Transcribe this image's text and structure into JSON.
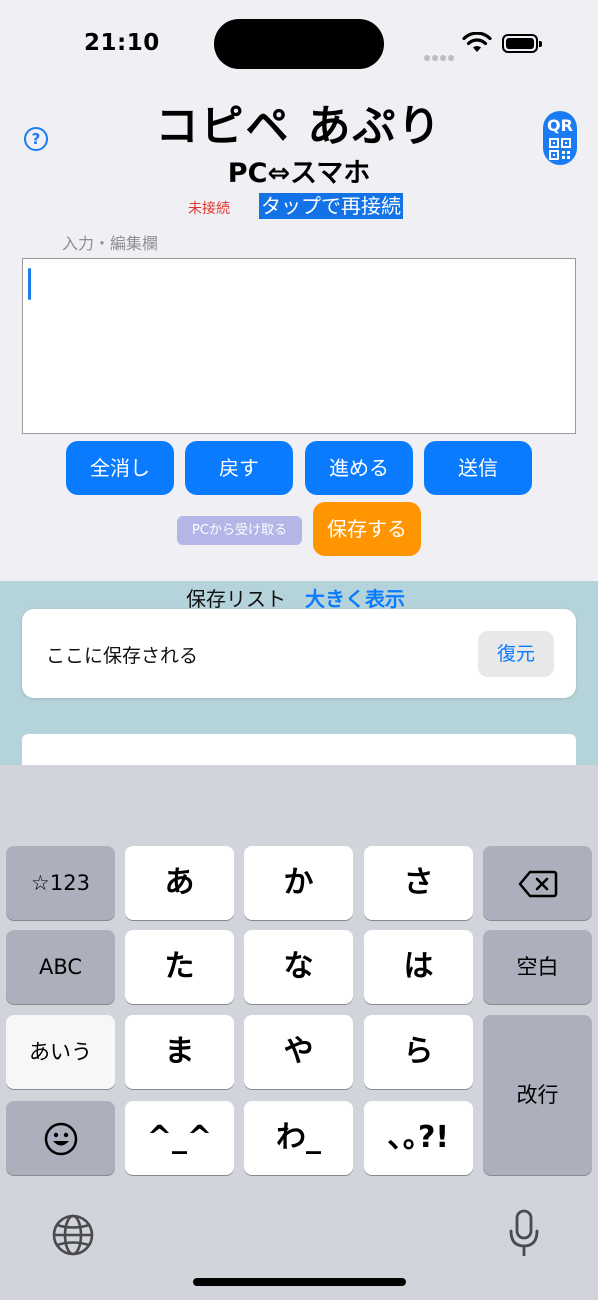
{
  "status_bar": {
    "time": "21:10"
  },
  "header": {
    "help_icon": "?",
    "title": "コピペ あぷり",
    "subtitle": "PC⇔スマホ",
    "qr_label": "QR"
  },
  "connection": {
    "status": "未接続",
    "reconnect_label": "タップで再接続"
  },
  "editor": {
    "label": "入力・編集欄",
    "value": ""
  },
  "actions": {
    "clear": "全消し",
    "back": "戻す",
    "forward": "進める",
    "send": "送信",
    "receive": "PCから受け取る",
    "save": "保存する"
  },
  "saved_list": {
    "title": "保存リスト",
    "large_view": "大きく表示",
    "items": [
      {
        "text": "ここに保存される",
        "restore": "復元"
      }
    ]
  },
  "keyboard": {
    "row1": [
      "☆123",
      "あ",
      "か",
      "さ"
    ],
    "row2": [
      "ABC",
      "た",
      "な",
      "は",
      "空白"
    ],
    "row3": [
      "あいう",
      "ま",
      "や",
      "ら"
    ],
    "row4": [
      "^_^",
      "わ_",
      "､｡?!"
    ],
    "enter": "改行",
    "backspace_icon": "backspace-icon",
    "emoji_icon": "emoji-icon",
    "globe_icon": "globe-icon",
    "mic_icon": "mic-icon"
  },
  "colors": {
    "accent": "#0a7aff",
    "save": "#ff9500",
    "receive": "#b3b6e6",
    "disconnected": "#e0352b",
    "list_background": "#b5d3da"
  }
}
